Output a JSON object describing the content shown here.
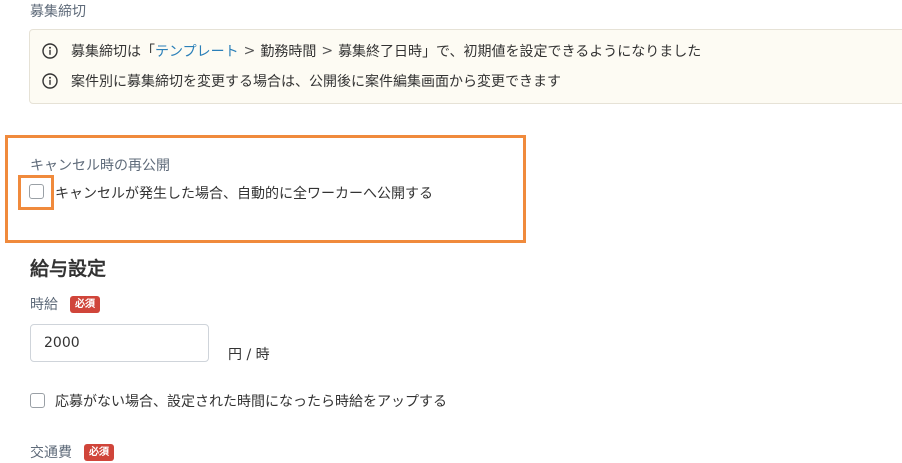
{
  "deadline": {
    "label": "募集締切",
    "info": {
      "line1_prefix": "募集締切は「",
      "line1_link": "テンプレート",
      "line1_sep1": ">",
      "line1_crumb2": "勤務時間",
      "line1_sep2": ">",
      "line1_crumb3": "募集終了日時",
      "line1_suffix": "」で、初期値を設定できるようになりました",
      "line2": "案件別に募集締切を変更する場合は、公開後に案件編集画面から変更できます"
    }
  },
  "cancel_repost": {
    "label": "キャンセル時の再公開",
    "checkbox_text": "キャンセルが発生した場合、自動的に全ワーカーへ公開する",
    "checked": false
  },
  "salary": {
    "heading": "給与設定",
    "hourly_label": "時給",
    "required_badge": "必須",
    "hourly_value": "2000",
    "unit": "円 / 時",
    "auto_raise_text": "応募がない場合、設定された時間になったら時給をアップする",
    "auto_raise_checked": false,
    "transport_label": "交通費",
    "transport_required_badge": "必須"
  },
  "colors": {
    "highlight": "#f08a3c",
    "link": "#2a7fb8",
    "required_badge": "#d0453a",
    "info_bg": "#fdfbf3"
  },
  "icons": {
    "info": "info-circle-icon"
  }
}
